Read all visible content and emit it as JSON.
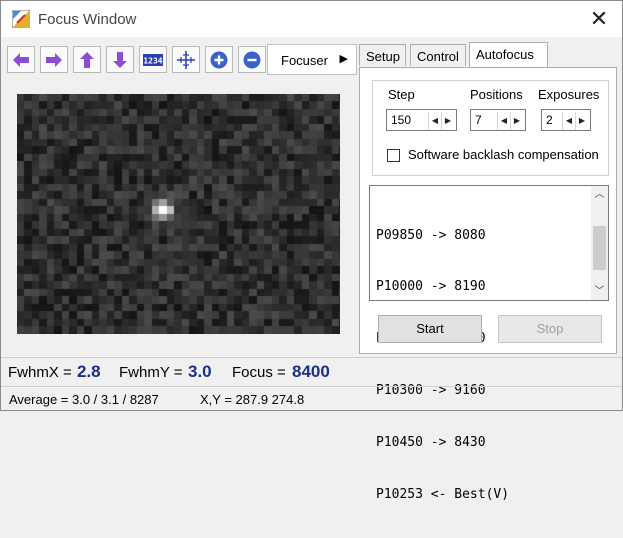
{
  "window": {
    "title": "Focus Window",
    "close_glyph": "✕"
  },
  "toolbar": {
    "buttons": [
      {
        "name": "move-left",
        "icon": "arrow-left-icon"
      },
      {
        "name": "move-right",
        "icon": "arrow-right-icon"
      },
      {
        "name": "move-up",
        "icon": "arrow-up-icon"
      },
      {
        "name": "move-down",
        "icon": "arrow-down-icon"
      },
      {
        "name": "numbers",
        "icon": "numbers-icon",
        "text": "1234"
      },
      {
        "name": "crosshair",
        "icon": "crosshair-icon"
      },
      {
        "name": "zoom-in",
        "icon": "plus-circle-icon"
      },
      {
        "name": "zoom-out",
        "icon": "minus-circle-icon"
      }
    ],
    "focuser_label": "Focuser",
    "focuser_arrow": "▶"
  },
  "tabs": [
    "Setup",
    "Control",
    "Autofocus"
  ],
  "active_tab": "Autofocus",
  "autofocus": {
    "step_label": "Step",
    "step_value": "150",
    "positions_label": "Positions",
    "positions_value": "7",
    "exposures_label": "Exposures",
    "exposures_value": "2",
    "backlash_label": "Software backlash compensation",
    "backlash_checked": false,
    "log_lines": [
      "P09850 -> 8080",
      "P10000 -> 8190",
      "P10150 -> 8890",
      "P10300 -> 9160",
      "P10450 -> 8430",
      "P10253 <- Best(V)"
    ],
    "start_label": "Start",
    "stop_label": "Stop"
  },
  "stats": {
    "fwhmx_label": "FwhmX =",
    "fwhmx_value": "2.8",
    "fwhmy_label": "FwhmY =",
    "fwhmy_value": "3.0",
    "focus_label": "Focus =",
    "focus_value": "8400"
  },
  "statusbar": {
    "average": "Average = 3.0 / 3.1 / 8287",
    "xy": "X,Y = 287.9  274.8"
  },
  "colors": {
    "stat_value": "#1a2f8a",
    "arrow_purple": "#7b3fc4"
  }
}
